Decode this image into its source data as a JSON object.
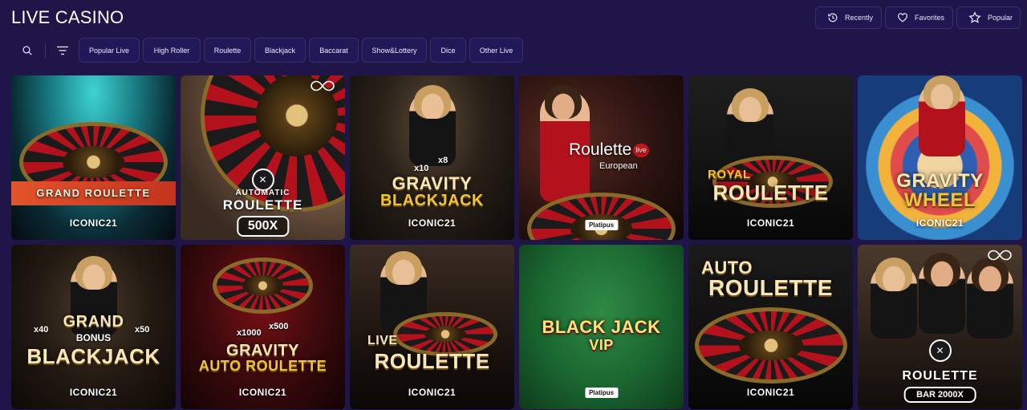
{
  "page": {
    "title": "LIVE CASINO"
  },
  "quick_filters": [
    {
      "label": "Recently",
      "icon": "history-icon"
    },
    {
      "label": "Favorites",
      "icon": "heart-icon"
    },
    {
      "label": "Popular",
      "icon": "star-icon"
    }
  ],
  "toolbar": {
    "search_icon": "search-icon",
    "filter_icon": "filter-icon"
  },
  "tabs": [
    "Popular Live",
    "High Roller",
    "Roulette",
    "Blackjack",
    "Baccarat",
    "Show&Lottery",
    "Dice",
    "Other Live"
  ],
  "games": [
    {
      "title": "GRAND ROULETTE",
      "provider": "ICONIC21"
    },
    {
      "title_top": "AUTOMATIC",
      "title": "ROULETTE",
      "badge": "500X"
    },
    {
      "title_top": "GRAVITY",
      "title": "BLACKJACK",
      "provider": "ICONIC21",
      "multipliers": [
        "x10",
        "x8"
      ]
    },
    {
      "title": "Roulette",
      "live_badge": "live",
      "subtitle": "European",
      "provider": "Platipus"
    },
    {
      "title_top": "ROYAL",
      "title": "ROULETTE",
      "provider": "ICONIC21"
    },
    {
      "title_top": "GRAVITY",
      "title": "WHEEL",
      "provider": "ICONIC21"
    },
    {
      "title_top": "GRAND",
      "middle": "BONUS",
      "title": "BLACKJACK",
      "provider": "ICONIC21",
      "multipliers": [
        "x40",
        "x50"
      ]
    },
    {
      "title_top": "GRAVITY",
      "title": "AUTO ROULETTE",
      "provider": "ICONIC21",
      "multipliers": [
        "x1000",
        "x500"
      ]
    },
    {
      "title_top": "LIVE",
      "title": "ROULETTE",
      "provider": "ICONIC21"
    },
    {
      "title_top": "BLACK JACK",
      "title": "VIP",
      "provider": "Platipus"
    },
    {
      "title_top": "AUTO",
      "title": "ROULETTE",
      "provider": "ICONIC21"
    },
    {
      "title": "ROULETTE",
      "badge": "BAR 2000X"
    }
  ],
  "colors": {
    "background": "#1f1549",
    "button_border": "#3a2f6e",
    "tab_background": "#211858"
  }
}
